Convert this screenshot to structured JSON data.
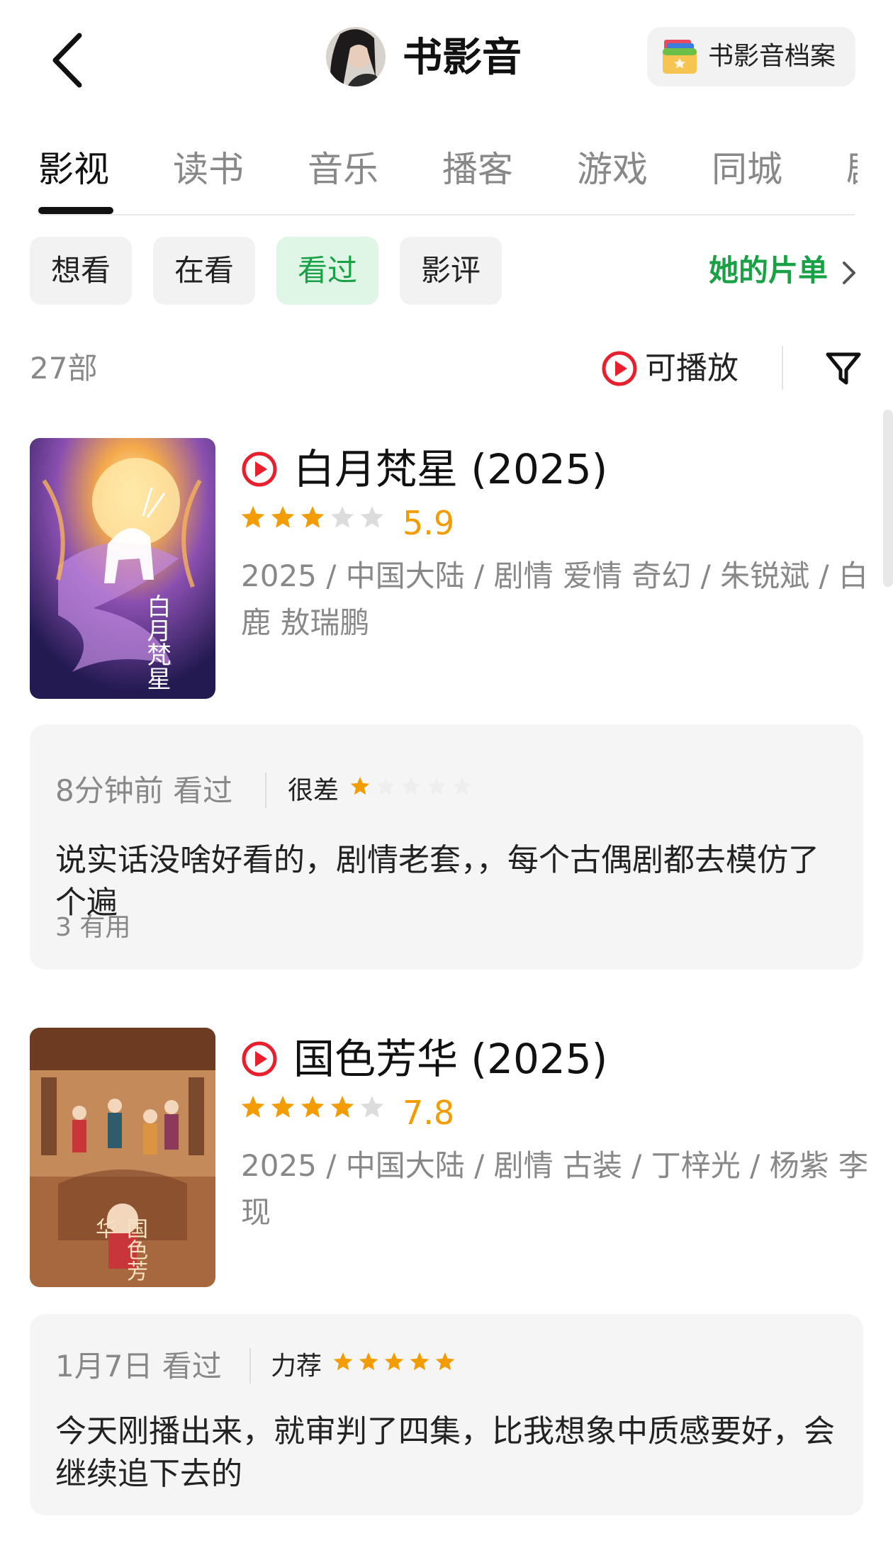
{
  "header": {
    "title": "书影音",
    "archive_label": "书影音档案"
  },
  "tabs": [
    "影视",
    "读书",
    "音乐",
    "播客",
    "游戏",
    "同城",
    "剧"
  ],
  "active_tab": 0,
  "filters": [
    "想看",
    "在看",
    "看过",
    "影评"
  ],
  "active_filter": 2,
  "her_list_label": "她的片单",
  "count_label": "27部",
  "playable_label": "可播放",
  "colors": {
    "accent_green": "#1aa146",
    "star_orange": "#f29c00",
    "play_red": "#e8202e"
  },
  "items": [
    {
      "title": "白月梵星 (2025)",
      "stars": 3,
      "rating": "5.9",
      "meta": "2025 / 中国大陆 / 剧情 爱情 奇幻 / 朱锐斌 / 白鹿 敖瑞鹏",
      "poster_text": "白月梵星",
      "review": {
        "time": "8分钟前 看过",
        "label": "很差",
        "stars": 1,
        "text": "说实话没啥好看的，剧情老套，，每个古偶剧都去模仿了个遍",
        "useful": "3 有用"
      }
    },
    {
      "title": "国色芳华 (2025)",
      "stars": 4,
      "rating": "7.8",
      "meta": "2025 / 中国大陆 / 剧情 古装 / 丁梓光 / 杨紫 李现",
      "poster_text": "国色芳华",
      "review": {
        "time": "1月7日 看过",
        "label": "力荐",
        "stars": 5,
        "text": "今天刚播出来，就审判了四集，比我想象中质感要好，会继续追下去的",
        "useful": ""
      }
    }
  ]
}
